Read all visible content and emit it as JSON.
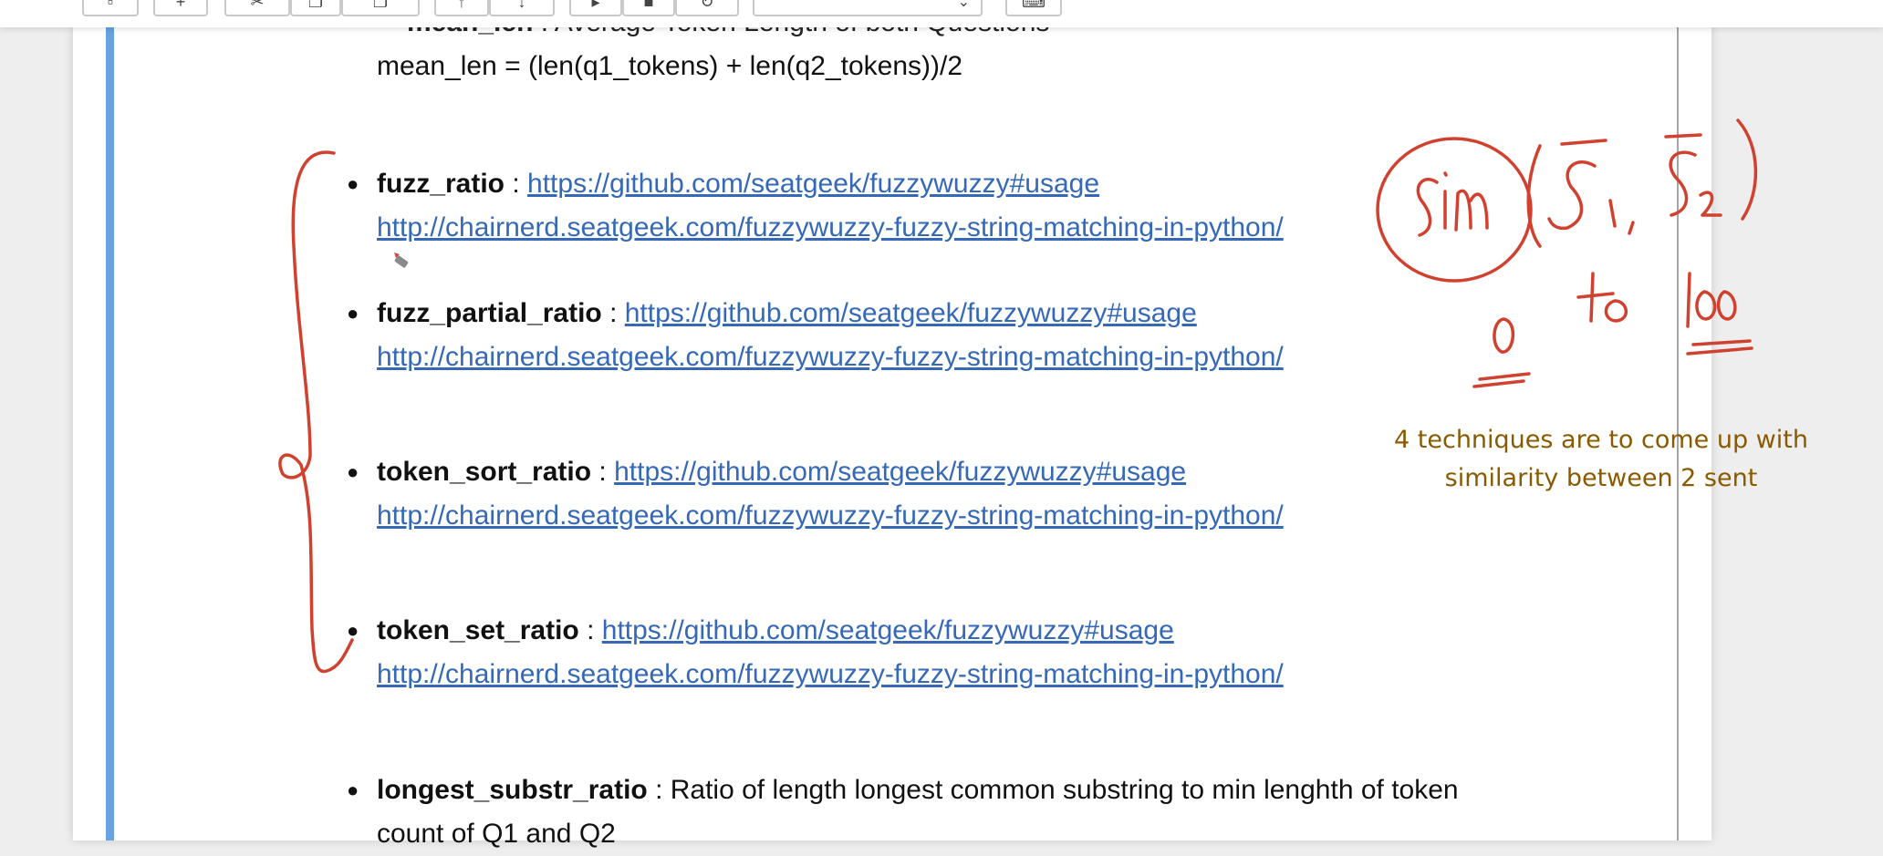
{
  "previous_item": {
    "term": "mean_len",
    "description": " : Average Token Length of both Questions",
    "formula": "mean_len = (len(q1_tokens) + len(q2_tokens))/2"
  },
  "features": [
    {
      "term": "fuzz_ratio",
      "separator": " : ",
      "link1": "https://github.com/seatgeek/fuzzywuzzy#usage",
      "link2": "http://chairnerd.seatgeek.com/fuzzywuzzy-fuzzy-string-matching-in-python/"
    },
    {
      "term": "fuzz_partial_ratio",
      "separator": " : ",
      "link1": "https://github.com/seatgeek/fuzzywuzzy#usage",
      "link2": "http://chairnerd.seatgeek.com/fuzzywuzzy-fuzzy-string-matching-in-python/"
    },
    {
      "term": "token_sort_ratio",
      "separator": " : ",
      "link1": "https://github.com/seatgeek/fuzzywuzzy#usage",
      "link2": "http://chairnerd.seatgeek.com/fuzzywuzzy-fuzzy-string-matching-in-python/"
    },
    {
      "term": "token_set_ratio",
      "separator": " : ",
      "link1": "https://github.com/seatgeek/fuzzywuzzy#usage",
      "link2": "http://chairnerd.seatgeek.com/fuzzywuzzy-fuzzy-string-matching-in-python/"
    }
  ],
  "longest_substr": {
    "term": "longest_substr_ratio",
    "separator": " : ",
    "description": "Ratio of length longest common substring to min lenghth of token",
    "description_line2": "count of Q1 and Q2"
  },
  "annotation_note": {
    "line1": "4 techniques are to come up with",
    "line2": "similarity between 2 sent"
  },
  "handwriting": {
    "formula": "sim(S1, S2)",
    "range": "0 to 100"
  },
  "colors": {
    "ink": "#d0412f",
    "link": "#3569b8",
    "note": "#8a5a00",
    "cell_bar": "#66a3e0"
  },
  "icons": [
    "save-icon",
    "add-icon",
    "cut-icon",
    "copy-icon",
    "paste-icon",
    "move-up-icon",
    "move-down-icon",
    "run-icon",
    "stop-icon",
    "restart-icon",
    "keyboard-icon",
    "chevron-down-icon",
    "pencil-cursor-icon"
  ]
}
